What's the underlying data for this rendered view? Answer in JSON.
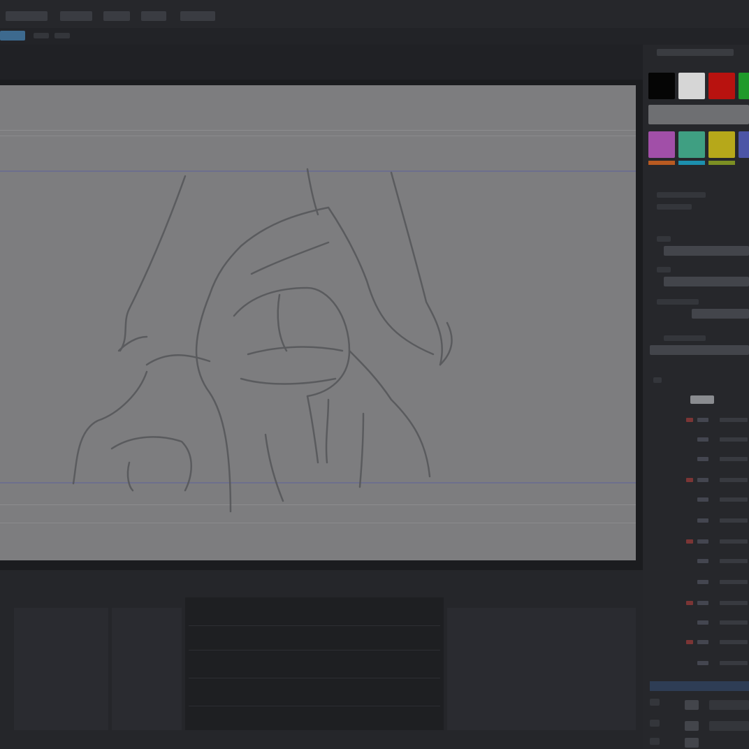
{
  "app": {
    "menus": [
      "",
      "",
      "",
      "",
      ""
    ]
  },
  "palette": {
    "swatches": [
      {
        "name": "black",
        "color": "#050505"
      },
      {
        "name": "white",
        "color": "#d6d6d6"
      },
      {
        "name": "red",
        "color": "#b8120f"
      },
      {
        "name": "green",
        "color": "#1f9a2b"
      },
      {
        "name": "magenta",
        "color": "#a14fa8"
      },
      {
        "name": "teal",
        "color": "#3f9f82"
      },
      {
        "name": "yellow",
        "color": "#b6a81a"
      },
      {
        "name": "blue",
        "color": "#4c55a6"
      }
    ]
  },
  "colors": {
    "accent": "#3d6a8f",
    "canvas": "#7d7d7f",
    "guide": "#6d6f8d"
  }
}
